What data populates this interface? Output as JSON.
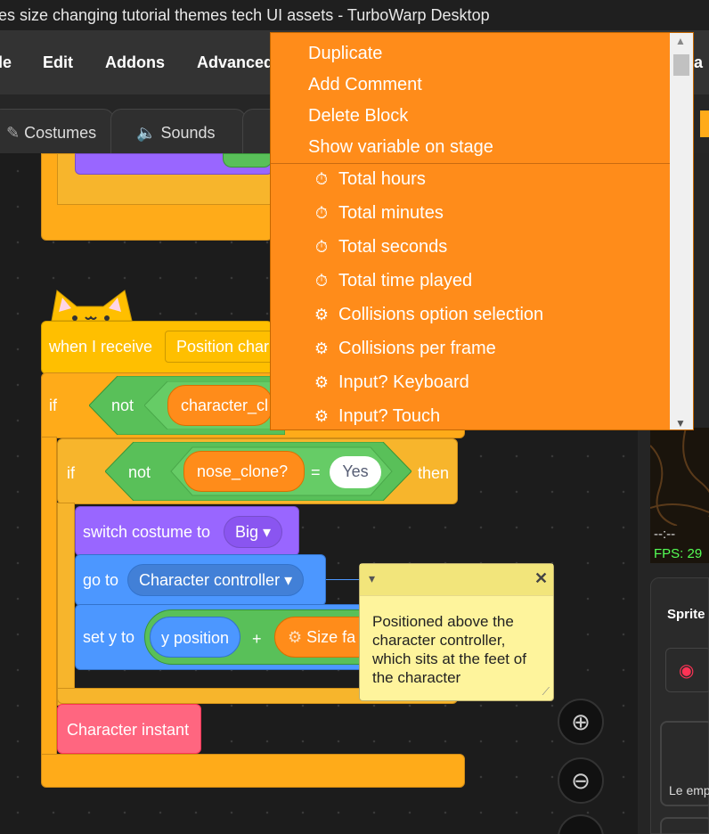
{
  "window": {
    "title": "es size changing tutorial themes tech UI assets - TurboWarp Desktop"
  },
  "menubar": {
    "items": [
      "le",
      "Edit",
      "Addons",
      "Advanced",
      "e a"
    ]
  },
  "tabs": {
    "costumes": "Costumes",
    "sounds": "Sounds"
  },
  "blocks": {
    "hat_label": "when I receive",
    "hat_dropdown": "Position char",
    "if1_label": "if",
    "not1_label": "not",
    "character_clone": "character_cl",
    "if2_label": "if",
    "not2_label": "not",
    "nose_clone": "nose_clone?",
    "equals": "=",
    "yes_value": "Yes",
    "then_label": "then",
    "switch_costume": "switch costume to",
    "costume_value": "Big",
    "goto_label": "go to",
    "goto_value": "Character controller",
    "sety_label": "set y to",
    "ypos": "y position",
    "plus": "+",
    "size_var": "Size fa",
    "char_instant": "Character instant"
  },
  "context_menu": {
    "actions": [
      "Duplicate",
      "Add Comment",
      "Delete Block",
      "Show variable on stage"
    ],
    "items": [
      {
        "icon": "stopwatch-icon",
        "label": "Total hours"
      },
      {
        "icon": "stopwatch-icon",
        "label": "Total minutes"
      },
      {
        "icon": "stopwatch-icon",
        "label": "Total seconds"
      },
      {
        "icon": "stopwatch-icon",
        "label": "Total time played"
      },
      {
        "icon": "gear-icon",
        "label": "Collisions option selection"
      },
      {
        "icon": "gear-icon",
        "label": "Collisions per frame"
      },
      {
        "icon": "gear-icon",
        "label": "Input? Keyboard"
      },
      {
        "icon": "gear-icon",
        "label": "Input? Touch"
      }
    ]
  },
  "comment": {
    "text": "Positioned above the character controller, which sits at the feet of the character"
  },
  "stage": {
    "clock": "--:--",
    "fps": "FPS: 29"
  },
  "sprite_panel": {
    "label": "Sprite",
    "sprite_name": "Le emp"
  },
  "colors": {
    "context_menu": "#ff8c1a",
    "events": "#ffbf00",
    "control": "#ffab19",
    "operators": "#59c059",
    "looks": "#9966ff",
    "motion": "#4c97ff",
    "custom": "#ff6680"
  }
}
